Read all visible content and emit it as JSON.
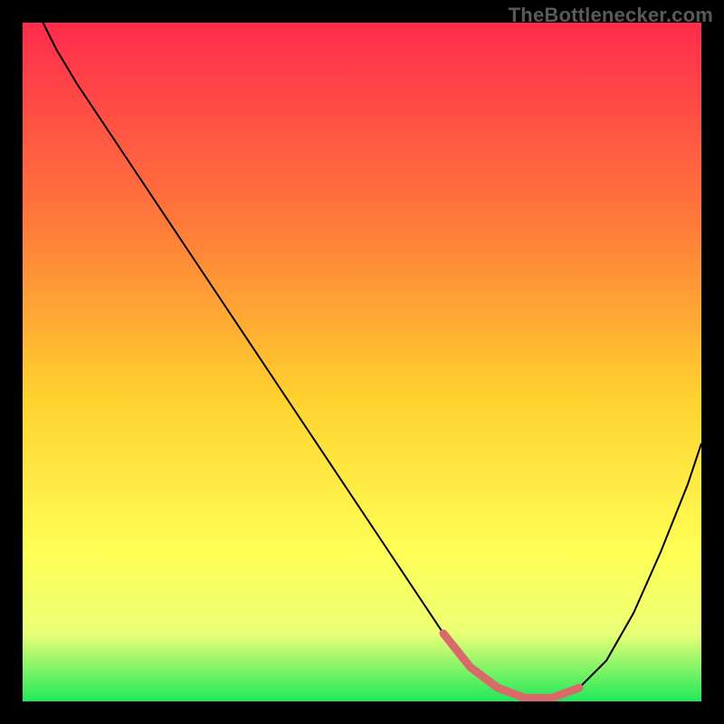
{
  "watermark": "TheBottlenecker.com",
  "colors": {
    "frame": "#000000",
    "curve": "#000000",
    "highlight": "#d96a6a",
    "grad_top": "#ff2b4d",
    "grad_mid_upper": "#ff7b3a",
    "grad_mid": "#ffd12e",
    "grad_mid_lower": "#ffff55",
    "grad_lower": "#eaff76",
    "grad_bottom": "#20e85a"
  },
  "chart_data": {
    "type": "line",
    "title": "",
    "xlabel": "",
    "ylabel": "",
    "xlim": [
      0,
      100
    ],
    "ylim": [
      100,
      0
    ],
    "legend": null,
    "grid": false,
    "series": [
      {
        "name": "curve",
        "x": [
          3,
          5,
          8,
          12,
          18,
          24,
          30,
          36,
          42,
          48,
          54,
          58,
          62,
          66,
          70,
          74,
          78,
          82,
          86,
          90,
          94,
          98,
          100
        ],
        "y": [
          0,
          4,
          9,
          15,
          24,
          33,
          42,
          51,
          60,
          69,
          78,
          84,
          90,
          95,
          98,
          99.5,
          99.5,
          98,
          94,
          87,
          78,
          68,
          62
        ]
      },
      {
        "name": "highlight",
        "x": [
          62,
          66,
          70,
          74,
          78,
          82
        ],
        "y": [
          90,
          95,
          98,
          99.5,
          99.5,
          98
        ]
      }
    ],
    "annotations": []
  }
}
